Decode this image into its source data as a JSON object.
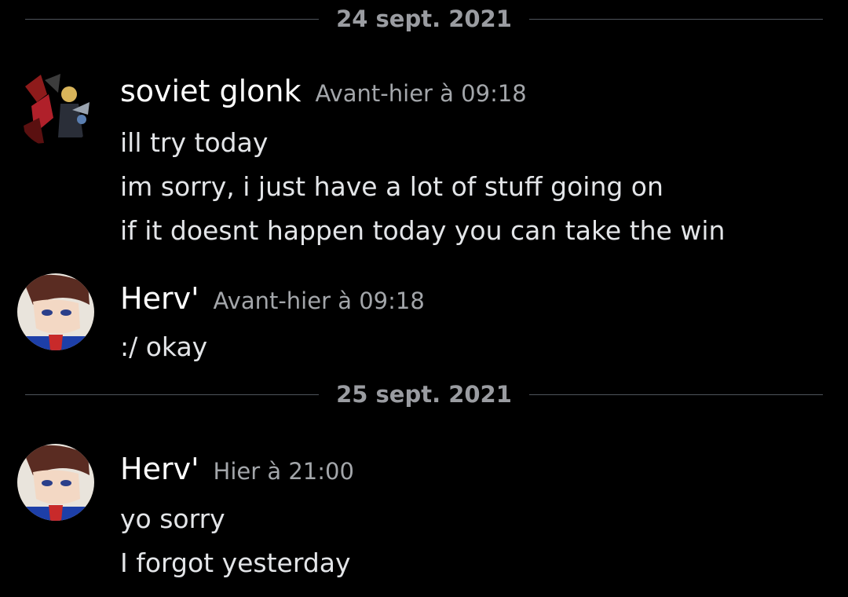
{
  "chat": {
    "dividers": [
      {
        "date": "24 sept. 2021"
      },
      {
        "date": "25 sept. 2021"
      }
    ],
    "messages": [
      {
        "username": "soviet glonk",
        "timestamp": "Avant-hier à 09:18",
        "lines": [
          "ill try today",
          "im sorry, i just have a lot of stuff going on",
          "if it doesnt happen today you can take the win"
        ]
      },
      {
        "username": "Herv'",
        "timestamp": "Avant-hier à 09:18",
        "lines": [
          ":/ okay"
        ]
      },
      {
        "username": "Herv'",
        "timestamp": "Hier à 21:00",
        "lines": [
          "yo sorry",
          "I forgot yesterday"
        ]
      }
    ]
  },
  "colors": {
    "background": "#000000",
    "username": "#ffffff",
    "timestamp": "#a3a6aa",
    "divider_line": "#4f545c",
    "divider_text": "#9a9ca1",
    "message_text": "#e3e5e8"
  }
}
